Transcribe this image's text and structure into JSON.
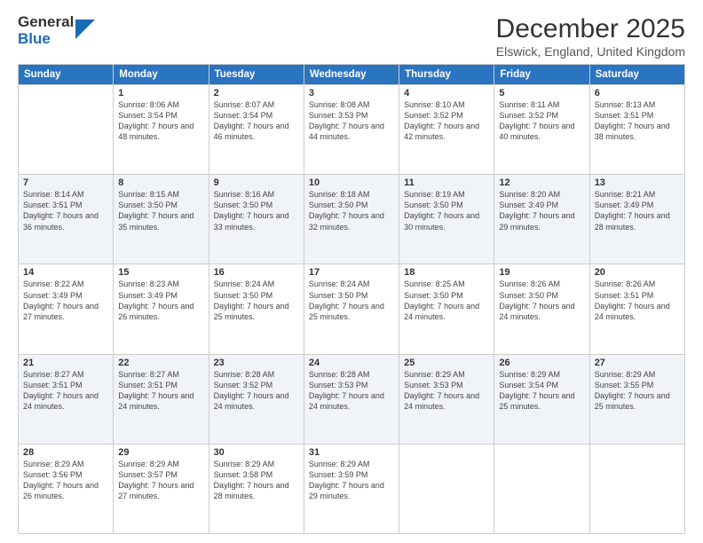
{
  "logo": {
    "line1": "General",
    "line2": "Blue"
  },
  "title": "December 2025",
  "location": "Elswick, England, United Kingdom",
  "days_of_week": [
    "Sunday",
    "Monday",
    "Tuesday",
    "Wednesday",
    "Thursday",
    "Friday",
    "Saturday"
  ],
  "weeks": [
    [
      {
        "day": "",
        "info": ""
      },
      {
        "day": "1",
        "info": "Sunrise: 8:06 AM\nSunset: 3:54 PM\nDaylight: 7 hours\nand 48 minutes."
      },
      {
        "day": "2",
        "info": "Sunrise: 8:07 AM\nSunset: 3:54 PM\nDaylight: 7 hours\nand 46 minutes."
      },
      {
        "day": "3",
        "info": "Sunrise: 8:08 AM\nSunset: 3:53 PM\nDaylight: 7 hours\nand 44 minutes."
      },
      {
        "day": "4",
        "info": "Sunrise: 8:10 AM\nSunset: 3:52 PM\nDaylight: 7 hours\nand 42 minutes."
      },
      {
        "day": "5",
        "info": "Sunrise: 8:11 AM\nSunset: 3:52 PM\nDaylight: 7 hours\nand 40 minutes."
      },
      {
        "day": "6",
        "info": "Sunrise: 8:13 AM\nSunset: 3:51 PM\nDaylight: 7 hours\nand 38 minutes."
      }
    ],
    [
      {
        "day": "7",
        "info": "Sunrise: 8:14 AM\nSunset: 3:51 PM\nDaylight: 7 hours\nand 36 minutes."
      },
      {
        "day": "8",
        "info": "Sunrise: 8:15 AM\nSunset: 3:50 PM\nDaylight: 7 hours\nand 35 minutes."
      },
      {
        "day": "9",
        "info": "Sunrise: 8:16 AM\nSunset: 3:50 PM\nDaylight: 7 hours\nand 33 minutes."
      },
      {
        "day": "10",
        "info": "Sunrise: 8:18 AM\nSunset: 3:50 PM\nDaylight: 7 hours\nand 32 minutes."
      },
      {
        "day": "11",
        "info": "Sunrise: 8:19 AM\nSunset: 3:50 PM\nDaylight: 7 hours\nand 30 minutes."
      },
      {
        "day": "12",
        "info": "Sunrise: 8:20 AM\nSunset: 3:49 PM\nDaylight: 7 hours\nand 29 minutes."
      },
      {
        "day": "13",
        "info": "Sunrise: 8:21 AM\nSunset: 3:49 PM\nDaylight: 7 hours\nand 28 minutes."
      }
    ],
    [
      {
        "day": "14",
        "info": "Sunrise: 8:22 AM\nSunset: 3:49 PM\nDaylight: 7 hours\nand 27 minutes."
      },
      {
        "day": "15",
        "info": "Sunrise: 8:23 AM\nSunset: 3:49 PM\nDaylight: 7 hours\nand 26 minutes."
      },
      {
        "day": "16",
        "info": "Sunrise: 8:24 AM\nSunset: 3:50 PM\nDaylight: 7 hours\nand 25 minutes."
      },
      {
        "day": "17",
        "info": "Sunrise: 8:24 AM\nSunset: 3:50 PM\nDaylight: 7 hours\nand 25 minutes."
      },
      {
        "day": "18",
        "info": "Sunrise: 8:25 AM\nSunset: 3:50 PM\nDaylight: 7 hours\nand 24 minutes."
      },
      {
        "day": "19",
        "info": "Sunrise: 8:26 AM\nSunset: 3:50 PM\nDaylight: 7 hours\nand 24 minutes."
      },
      {
        "day": "20",
        "info": "Sunrise: 8:26 AM\nSunset: 3:51 PM\nDaylight: 7 hours\nand 24 minutes."
      }
    ],
    [
      {
        "day": "21",
        "info": "Sunrise: 8:27 AM\nSunset: 3:51 PM\nDaylight: 7 hours\nand 24 minutes."
      },
      {
        "day": "22",
        "info": "Sunrise: 8:27 AM\nSunset: 3:51 PM\nDaylight: 7 hours\nand 24 minutes."
      },
      {
        "day": "23",
        "info": "Sunrise: 8:28 AM\nSunset: 3:52 PM\nDaylight: 7 hours\nand 24 minutes."
      },
      {
        "day": "24",
        "info": "Sunrise: 8:28 AM\nSunset: 3:53 PM\nDaylight: 7 hours\nand 24 minutes."
      },
      {
        "day": "25",
        "info": "Sunrise: 8:29 AM\nSunset: 3:53 PM\nDaylight: 7 hours\nand 24 minutes."
      },
      {
        "day": "26",
        "info": "Sunrise: 8:29 AM\nSunset: 3:54 PM\nDaylight: 7 hours\nand 25 minutes."
      },
      {
        "day": "27",
        "info": "Sunrise: 8:29 AM\nSunset: 3:55 PM\nDaylight: 7 hours\nand 25 minutes."
      }
    ],
    [
      {
        "day": "28",
        "info": "Sunrise: 8:29 AM\nSunset: 3:56 PM\nDaylight: 7 hours\nand 26 minutes."
      },
      {
        "day": "29",
        "info": "Sunrise: 8:29 AM\nSunset: 3:57 PM\nDaylight: 7 hours\nand 27 minutes."
      },
      {
        "day": "30",
        "info": "Sunrise: 8:29 AM\nSunset: 3:58 PM\nDaylight: 7 hours\nand 28 minutes."
      },
      {
        "day": "31",
        "info": "Sunrise: 8:29 AM\nSunset: 3:59 PM\nDaylight: 7 hours\nand 29 minutes."
      },
      {
        "day": "",
        "info": ""
      },
      {
        "day": "",
        "info": ""
      },
      {
        "day": "",
        "info": ""
      }
    ]
  ]
}
